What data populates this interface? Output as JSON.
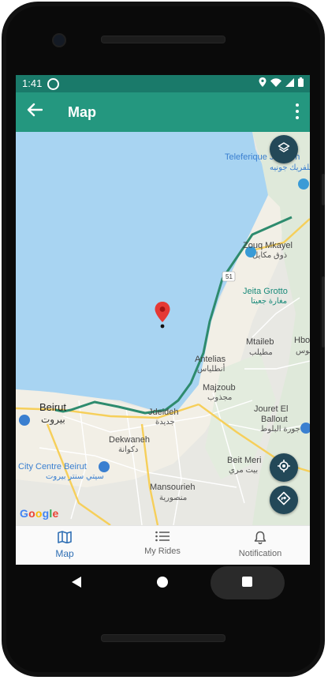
{
  "status_bar": {
    "time": "1:41"
  },
  "app_bar": {
    "title": "Map"
  },
  "map": {
    "labels": {
      "teleferique": "Teleferique Jounieh",
      "teleferique_ar": "تلفريك جونيه",
      "zouq": "Zouq Mkayel",
      "zouq_ar": "ذوق مكايل",
      "road_51": "51",
      "jeita": "Jeita Grotto",
      "jeita_ar": "مغارة جعيتا",
      "mtaileb": "Mtaileb",
      "mtaileb_ar": "مطيلب",
      "hbo": "Hbo",
      "hbo_ar": "بوس",
      "antelias": "Antelias",
      "antelias_ar": "أنطلياس",
      "majzoub": "Majzoub",
      "majzoub_ar": "مجذوب",
      "beirut": "Beirut",
      "beirut_ar": "بيروت",
      "jdeideh": "Jdeideh",
      "jdeideh_ar": "جديدة",
      "jouret": "Jouret El",
      "ballout": "Ballout",
      "ballout_ar": "جورة البلوط",
      "dekwaneh": "Dekwaneh",
      "dekwaneh_ar": "دكوانة",
      "city_centre": "City Centre Beirut",
      "city_centre_ar": "سيتي سنتر بيروت",
      "beit_meri": "Beit Meri",
      "beit_meri_ar": "بيت مري",
      "mansourieh": "Mansourieh",
      "mansourieh_ar": "منصورية",
      "google": "Google"
    },
    "colors": {
      "sea": "#a8d4f2",
      "land": "#e8e8e3",
      "route": "#2e8b6e"
    }
  },
  "bottom_nav": {
    "items": [
      {
        "label": "Map",
        "icon": "map-icon",
        "active": true
      },
      {
        "label": "My Rides",
        "icon": "list-icon",
        "active": false
      },
      {
        "label": "Notification",
        "icon": "bell-icon",
        "active": false
      }
    ]
  },
  "theme": {
    "primary": "#24977f",
    "status_bar": "#1a7a6a",
    "fab": "#234858",
    "active_nav": "#2f6fb4"
  }
}
